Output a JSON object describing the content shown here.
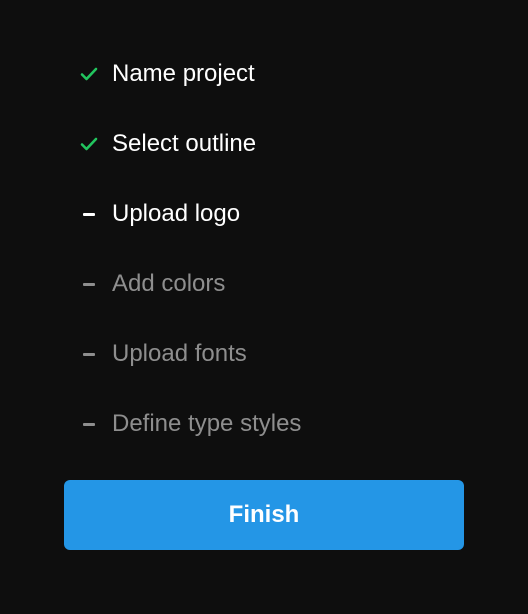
{
  "colors": {
    "background": "#0e0e0e",
    "check": "#22c55e",
    "active_text": "#ffffff",
    "pending_text": "#8e8e8e",
    "button": "#2496e6"
  },
  "steps": [
    {
      "label": "Name project",
      "status": "done",
      "icon": "check-icon"
    },
    {
      "label": "Select outline",
      "status": "done",
      "icon": "check-icon"
    },
    {
      "label": "Upload logo",
      "status": "current",
      "icon": "dash-icon"
    },
    {
      "label": "Add colors",
      "status": "pending",
      "icon": "dash-icon"
    },
    {
      "label": "Upload fonts",
      "status": "pending",
      "icon": "dash-icon"
    },
    {
      "label": "Define type styles",
      "status": "pending",
      "icon": "dash-icon"
    }
  ],
  "finish_button": {
    "label": "Finish"
  }
}
